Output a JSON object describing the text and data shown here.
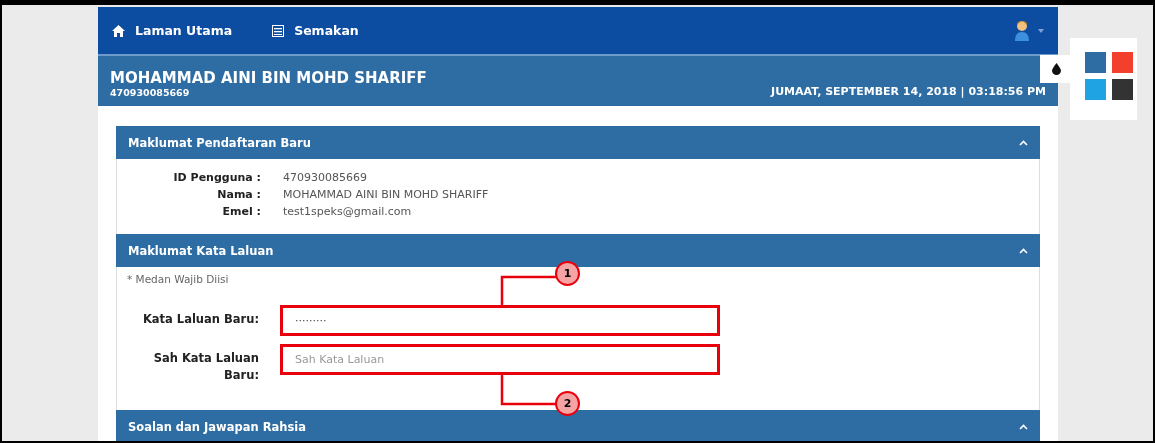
{
  "nav": {
    "items": [
      {
        "label": "Laman Utama"
      },
      {
        "label": "Semakan"
      }
    ]
  },
  "header": {
    "name": "MOHAMMAD AINI BIN MOHD SHARIFF",
    "id": "470930085669",
    "datetime": "JUMAAT, SEPTEMBER 14, 2018 | 03:18:56 PM"
  },
  "sections": [
    {
      "title": "Maklumat Pendaftaran Baru",
      "expanded": true,
      "kind": "info",
      "rows": [
        {
          "label": "ID Pengguna :",
          "value": "470930085669"
        },
        {
          "label": "Nama :",
          "value": "MOHAMMAD AINI BIN MOHD SHARIFF"
        },
        {
          "label": "Emel :",
          "value": "test1speks@gmail.com"
        }
      ]
    },
    {
      "title": "Maklumat Kata Laluan",
      "expanded": true,
      "kind": "form",
      "note": "* Medan Wajib Diisi",
      "fields": [
        {
          "label": "Kata Laluan Baru:",
          "value": "·········",
          "callout": {
            "number": "1",
            "above": true
          }
        },
        {
          "label": "Sah Kata Laluan Baru:",
          "placeholder": "Sah Kata Laluan",
          "callout": {
            "number": "2",
            "above": false
          }
        }
      ]
    },
    {
      "title": "Soalan dan Jawapan Rahsia",
      "expanded": true
    }
  ],
  "palette": {
    "swatches": [
      {
        "color": "#2e6da4"
      },
      {
        "color": "#f2402d"
      },
      {
        "color": "#1fa3e3"
      },
      {
        "color": "#333333"
      }
    ]
  }
}
